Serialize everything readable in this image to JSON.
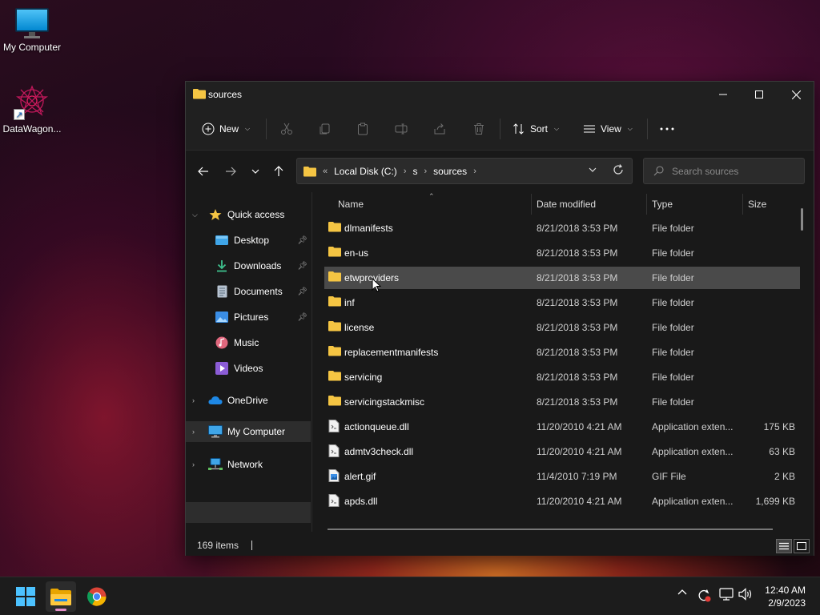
{
  "desktop": {
    "icons": [
      {
        "label": "My Computer"
      },
      {
        "label": "DataWagon..."
      }
    ]
  },
  "window": {
    "title": "sources",
    "toolbar": {
      "new_label": "New",
      "sort_label": "Sort",
      "view_label": "View"
    },
    "address": {
      "crumbs": [
        "Local Disk (C:)",
        "s",
        "sources"
      ],
      "overflow": "«"
    },
    "search": {
      "placeholder": "Search sources"
    },
    "navpane": {
      "items": [
        {
          "label": "Quick access",
          "icon": "star-icon",
          "level": 0,
          "expanded": true
        },
        {
          "label": "Desktop",
          "icon": "desktop-folder-icon",
          "level": 1,
          "pinned": true
        },
        {
          "label": "Downloads",
          "icon": "downloads-icon",
          "level": 1,
          "pinned": true
        },
        {
          "label": "Documents",
          "icon": "documents-icon",
          "level": 1,
          "pinned": true
        },
        {
          "label": "Pictures",
          "icon": "pictures-icon",
          "level": 1,
          "pinned": true
        },
        {
          "label": "Music",
          "icon": "music-icon",
          "level": 1,
          "pinned": false
        },
        {
          "label": "Videos",
          "icon": "videos-icon",
          "level": 1,
          "pinned": false
        },
        {
          "label": "OneDrive",
          "icon": "cloud-icon",
          "level": 0,
          "expanded": false
        },
        {
          "label": "My Computer",
          "icon": "computer-icon",
          "level": 0,
          "expanded": false,
          "selected": true
        },
        {
          "label": "Network",
          "icon": "network-icon",
          "level": 0,
          "expanded": false
        }
      ]
    },
    "columns": [
      "Name",
      "Date modified",
      "Type",
      "Size"
    ],
    "files": [
      {
        "name": "dlmanifests",
        "date": "8/21/2018 3:53 PM",
        "type": "File folder",
        "size": "",
        "kind": "folder"
      },
      {
        "name": "en-us",
        "date": "8/21/2018 3:53 PM",
        "type": "File folder",
        "size": "",
        "kind": "folder"
      },
      {
        "name": "etwproviders",
        "date": "8/21/2018 3:53 PM",
        "type": "File folder",
        "size": "",
        "kind": "folder",
        "selected": true
      },
      {
        "name": "inf",
        "date": "8/21/2018 3:53 PM",
        "type": "File folder",
        "size": "",
        "kind": "folder"
      },
      {
        "name": "license",
        "date": "8/21/2018 3:53 PM",
        "type": "File folder",
        "size": "",
        "kind": "folder"
      },
      {
        "name": "replacementmanifests",
        "date": "8/21/2018 3:53 PM",
        "type": "File folder",
        "size": "",
        "kind": "folder"
      },
      {
        "name": "servicing",
        "date": "8/21/2018 3:53 PM",
        "type": "File folder",
        "size": "",
        "kind": "folder"
      },
      {
        "name": "servicingstackmisc",
        "date": "8/21/2018 3:53 PM",
        "type": "File folder",
        "size": "",
        "kind": "folder"
      },
      {
        "name": "actionqueue.dll",
        "date": "11/20/2010 4:21 AM",
        "type": "Application exten...",
        "size": "175 KB",
        "kind": "dll"
      },
      {
        "name": "admtv3check.dll",
        "date": "11/20/2010 4:21 AM",
        "type": "Application exten...",
        "size": "63 KB",
        "kind": "dll"
      },
      {
        "name": "alert.gif",
        "date": "11/4/2010 7:19 PM",
        "type": "GIF File",
        "size": "2 KB",
        "kind": "image"
      },
      {
        "name": "apds.dll",
        "date": "11/20/2010 4:21 AM",
        "type": "Application exten...",
        "size": "1,699 KB",
        "kind": "dll"
      }
    ],
    "status": {
      "item_count": "169 items"
    }
  },
  "taskbar": {
    "apps": [
      {
        "name": "start",
        "icon": "windows-logo-icon"
      },
      {
        "name": "file-explorer",
        "icon": "file-explorer-icon",
        "active": true
      },
      {
        "name": "chrome",
        "icon": "chrome-icon"
      }
    ],
    "clock": {
      "time": "12:40 AM",
      "date": "2/9/2023"
    }
  },
  "colors": {
    "folder": "#f5c543",
    "accent": "#60cdff",
    "selection": "#4a4a4a"
  }
}
